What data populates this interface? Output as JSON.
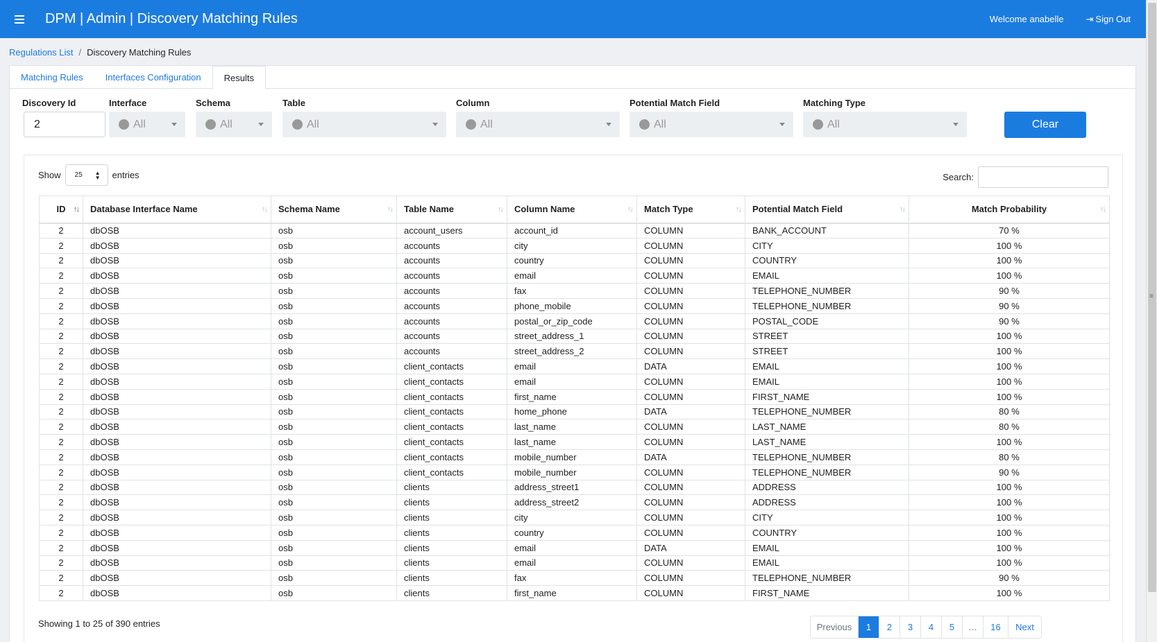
{
  "header": {
    "title": "DPM | Admin | Discovery Matching Rules",
    "welcome": "Welcome anabelle",
    "signout": "Sign Out",
    "menu_icon": "hamburger-icon",
    "signout_icon": "sign-out-icon"
  },
  "breadcrumb": {
    "parent": "Regulations List",
    "separator": "/",
    "current": "Discovery Matching Rules"
  },
  "tabs": [
    {
      "label": "Matching Rules",
      "active": false
    },
    {
      "label": "Interfaces Configuration",
      "active": false
    },
    {
      "label": "Results",
      "active": true
    }
  ],
  "filters": {
    "discovery_id": {
      "label": "Discovery Id",
      "value": "2"
    },
    "interface": {
      "label": "Interface",
      "value": "All"
    },
    "schema": {
      "label": "Schema",
      "value": "All"
    },
    "table": {
      "label": "Table",
      "value": "All"
    },
    "column": {
      "label": "Column",
      "value": "All"
    },
    "potential_match_field": {
      "label": "Potential Match Field",
      "value": "All"
    },
    "matching_type": {
      "label": "Matching Type",
      "value": "All"
    },
    "clear_label": "Clear"
  },
  "table_controls": {
    "show_label": "Show",
    "entries_value": "25",
    "entries_label": "entries",
    "search_label": "Search:",
    "search_value": ""
  },
  "columns": [
    "ID",
    "Database Interface Name",
    "Schema Name",
    "Table Name",
    "Column Name",
    "Match Type",
    "Potential Match Field",
    "Match Probability"
  ],
  "rows": [
    [
      "2",
      "dbOSB",
      "osb",
      "account_users",
      "account_id",
      "COLUMN",
      "BANK_ACCOUNT",
      "70 %"
    ],
    [
      "2",
      "dbOSB",
      "osb",
      "accounts",
      "city",
      "COLUMN",
      "CITY",
      "100 %"
    ],
    [
      "2",
      "dbOSB",
      "osb",
      "accounts",
      "country",
      "COLUMN",
      "COUNTRY",
      "100 %"
    ],
    [
      "2",
      "dbOSB",
      "osb",
      "accounts",
      "email",
      "COLUMN",
      "EMAIL",
      "100 %"
    ],
    [
      "2",
      "dbOSB",
      "osb",
      "accounts",
      "fax",
      "COLUMN",
      "TELEPHONE_NUMBER",
      "90 %"
    ],
    [
      "2",
      "dbOSB",
      "osb",
      "accounts",
      "phone_mobile",
      "COLUMN",
      "TELEPHONE_NUMBER",
      "90 %"
    ],
    [
      "2",
      "dbOSB",
      "osb",
      "accounts",
      "postal_or_zip_code",
      "COLUMN",
      "POSTAL_CODE",
      "90 %"
    ],
    [
      "2",
      "dbOSB",
      "osb",
      "accounts",
      "street_address_1",
      "COLUMN",
      "STREET",
      "100 %"
    ],
    [
      "2",
      "dbOSB",
      "osb",
      "accounts",
      "street_address_2",
      "COLUMN",
      "STREET",
      "100 %"
    ],
    [
      "2",
      "dbOSB",
      "osb",
      "client_contacts",
      "email",
      "DATA",
      "EMAIL",
      "100 %"
    ],
    [
      "2",
      "dbOSB",
      "osb",
      "client_contacts",
      "email",
      "COLUMN",
      "EMAIL",
      "100 %"
    ],
    [
      "2",
      "dbOSB",
      "osb",
      "client_contacts",
      "first_name",
      "COLUMN",
      "FIRST_NAME",
      "100 %"
    ],
    [
      "2",
      "dbOSB",
      "osb",
      "client_contacts",
      "home_phone",
      "DATA",
      "TELEPHONE_NUMBER",
      "80 %"
    ],
    [
      "2",
      "dbOSB",
      "osb",
      "client_contacts",
      "last_name",
      "COLUMN",
      "LAST_NAME",
      "80 %"
    ],
    [
      "2",
      "dbOSB",
      "osb",
      "client_contacts",
      "last_name",
      "COLUMN",
      "LAST_NAME",
      "100 %"
    ],
    [
      "2",
      "dbOSB",
      "osb",
      "client_contacts",
      "mobile_number",
      "DATA",
      "TELEPHONE_NUMBER",
      "80 %"
    ],
    [
      "2",
      "dbOSB",
      "osb",
      "client_contacts",
      "mobile_number",
      "COLUMN",
      "TELEPHONE_NUMBER",
      "90 %"
    ],
    [
      "2",
      "dbOSB",
      "osb",
      "clients",
      "address_street1",
      "COLUMN",
      "ADDRESS",
      "100 %"
    ],
    [
      "2",
      "dbOSB",
      "osb",
      "clients",
      "address_street2",
      "COLUMN",
      "ADDRESS",
      "100 %"
    ],
    [
      "2",
      "dbOSB",
      "osb",
      "clients",
      "city",
      "COLUMN",
      "CITY",
      "100 %"
    ],
    [
      "2",
      "dbOSB",
      "osb",
      "clients",
      "country",
      "COLUMN",
      "COUNTRY",
      "100 %"
    ],
    [
      "2",
      "dbOSB",
      "osb",
      "clients",
      "email",
      "DATA",
      "EMAIL",
      "100 %"
    ],
    [
      "2",
      "dbOSB",
      "osb",
      "clients",
      "email",
      "COLUMN",
      "EMAIL",
      "100 %"
    ],
    [
      "2",
      "dbOSB",
      "osb",
      "clients",
      "fax",
      "COLUMN",
      "TELEPHONE_NUMBER",
      "90 %"
    ],
    [
      "2",
      "dbOSB",
      "osb",
      "clients",
      "first_name",
      "COLUMN",
      "FIRST_NAME",
      "100 %"
    ]
  ],
  "info": "Showing 1 to 25 of 390 entries",
  "pagination": [
    "Previous",
    "1",
    "2",
    "3",
    "4",
    "5",
    "…",
    "16",
    "Next"
  ],
  "pagination_active": "1",
  "colors": {
    "primary": "#1b7ce0"
  }
}
